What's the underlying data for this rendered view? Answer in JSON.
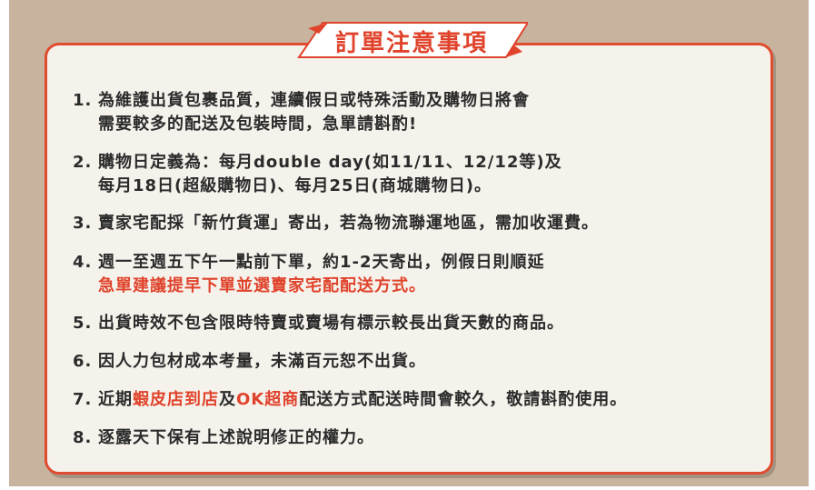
{
  "title": "訂單注意事項",
  "colors": {
    "accent": "#e0432b",
    "panel": "#f5f2ec",
    "background": "#c8b49e",
    "text": "#2b2b2b"
  },
  "items": [
    {
      "num": "1.",
      "line1": "為維護出貨包裹品質，連續假日或特殊活動及購物日將會",
      "line2": "需要較多的配送及包裝時間，急單請斟酌!"
    },
    {
      "num": "2.",
      "line1": "購物日定義為：每月double day(如11/11、12/12等)及",
      "line2": "每月18日(超級購物日)、每月25日(商城購物日)。"
    },
    {
      "num": "3.",
      "line1": "賣家宅配採「新竹貨運」寄出，若為物流聯運地區，需加收運費。"
    },
    {
      "num": "4.",
      "line1": "週一至週五下午一點前下單，約1-2天寄出，例假日則順延",
      "line2": "急單建議提早下單並選賣家宅配配送方式。"
    },
    {
      "num": "5.",
      "line1": "出貨時效不包含限時特賣或賣場有標示較長出貨天數的商品。"
    },
    {
      "num": "6.",
      "line1": "因人力包材成本考量，未滿百元恕不出貨。"
    },
    {
      "num": "7.",
      "part1": "近期",
      "red1": "蝦皮店到店",
      "part2": "及",
      "red2": "OK超商",
      "part3": "配送方式配送時間會較久，敬請斟酌使用。"
    },
    {
      "num": "8.",
      "line1": "逐露天下保有上述說明修正的權力。"
    }
  ]
}
